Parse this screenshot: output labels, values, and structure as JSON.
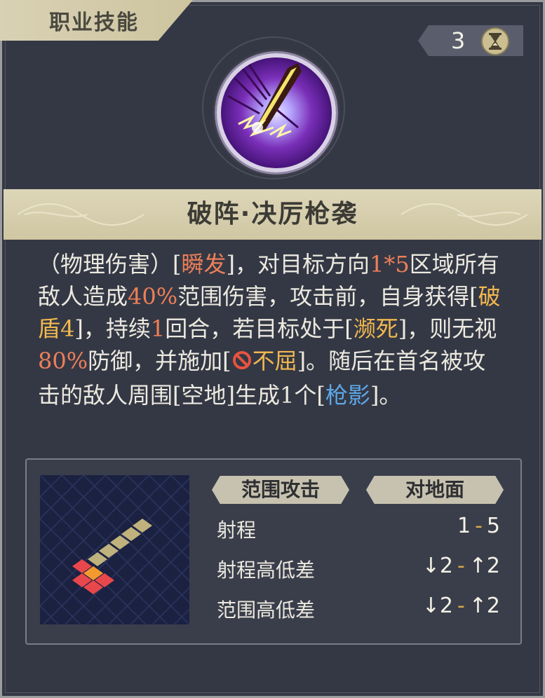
{
  "category": {
    "label": "职业技能"
  },
  "cost": {
    "value": "3",
    "icon": "hourglass-icon"
  },
  "skill": {
    "name": "破阵·决厉枪袭"
  },
  "description": {
    "p1": "（物理伤害）[",
    "kw_instant": "瞬发",
    "p2": "]，对目标方向",
    "area": "1*5",
    "p3": "区域所有敌人造成",
    "dmg_pct": "40%",
    "p4": "范围伤害，攻击前，自身获得[",
    "kw_break": "破盾4",
    "p5": "]，持续",
    "duration": "1",
    "p6": "回合，若目标处于[",
    "kw_dying": "濒死",
    "p7": "]，则无视",
    "ignore_pct": "80%",
    "p8": "防御，并施加[",
    "kw_unyield": "不屈",
    "p9": "]。随后在首名被攻击的敌人周围[空地]生成1个[",
    "kw_shadow": "枪影",
    "p10": "]。"
  },
  "stats": {
    "tag_attack": "范围攻击",
    "tag_target": "对地面",
    "rows": [
      {
        "label": "射程",
        "min": "1",
        "max": "5"
      },
      {
        "label": "射程高低差",
        "min": "↓2",
        "max": "↑2"
      },
      {
        "label": "范围高低差",
        "min": "↓2",
        "max": "↑2"
      }
    ],
    "separator": "-"
  },
  "colors": {
    "red": "#ee7f57",
    "gold": "#f2b84f",
    "blue": "#5da7e6",
    "band": "#d5cdae"
  }
}
